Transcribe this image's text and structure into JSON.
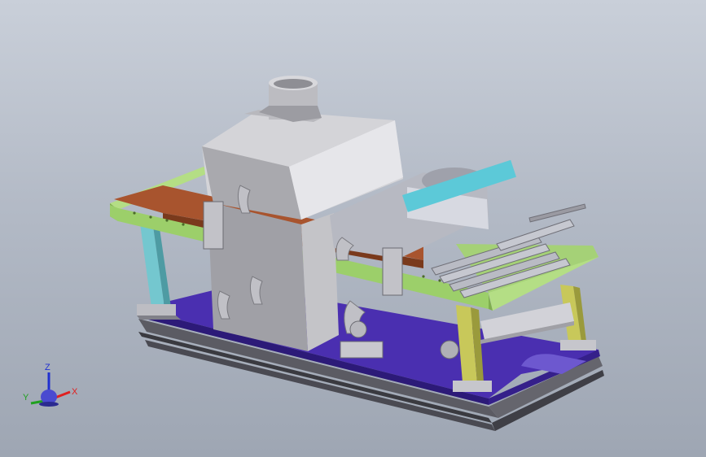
{
  "viewport": {
    "background_top": "#c9cfd9",
    "background_bottom": "#9ea6b3"
  },
  "triad": {
    "z_label": "Z",
    "y_label": "Y",
    "x_label": "X",
    "colors": {
      "x": "#e02020",
      "y": "#20a020",
      "z": "#2030d0"
    }
  },
  "model": {
    "colors": {
      "hood": "#c4c4c8",
      "frame_green": "#9ccf6a",
      "frame_rust": "#a8542e",
      "base_purple": "#4a2fb0",
      "rail_dark": "#555560",
      "leg_cyan": "#74c7cf",
      "leg_yellow": "#c8c85a",
      "lamp_gray": "#b7b9c2"
    }
  }
}
